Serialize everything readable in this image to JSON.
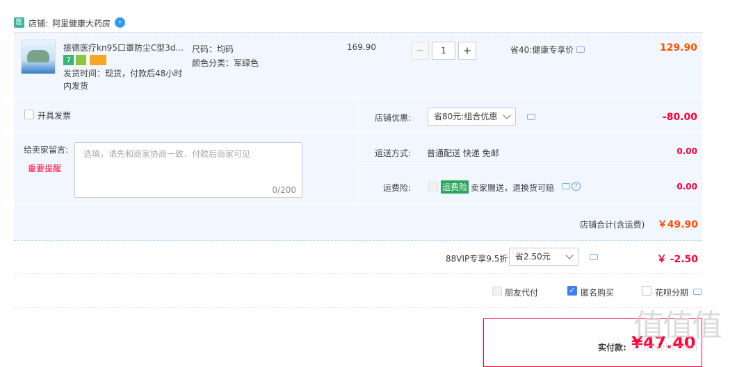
{
  "shop": {
    "label": "店铺:",
    "name": "阿里健康大药房",
    "shop_icon": "pharmacy-shop-icon",
    "badge_icon": "wangwang-chat-icon"
  },
  "item": {
    "title": "振德医疗kn95口罩防尘C型3d...",
    "ship_time": "发货时间：现货，付款后48小时内发货",
    "attr_size": "尺码：均码",
    "attr_color": "颜色分类：军绿色",
    "unit_price": "169.90",
    "quantity": "1",
    "qty_minus": "−",
    "qty_plus": "+",
    "discount": "省40:健康专享价",
    "subtotal": "129.90",
    "badge_7": "7"
  },
  "invoice": {
    "label": "开具发票"
  },
  "message": {
    "label": "给卖家留言:",
    "warn": "重要提醒",
    "placeholder": "选填，请先和商家协商一致，付款后商家可见",
    "count": "0/200"
  },
  "shop_promo": {
    "label": "店铺优惠:",
    "selected": "省80元:组合优惠",
    "amount": "-80.00"
  },
  "delivery": {
    "label": "运送方式:",
    "value": "普通配送 快递 免邮",
    "amount": "0.00"
  },
  "insurance": {
    "label": "运费险:",
    "tag": "运费险",
    "text": "卖家赠送，退换货可赔",
    "amount": "0.00"
  },
  "shop_total": {
    "label": "店铺合计(含运费)",
    "amount": "￥49.90"
  },
  "vip": {
    "label": "88VIP专享9.5折",
    "selected": "省2.50元",
    "amount": "￥ -2.50"
  },
  "options": {
    "friend_pay": "朋友代付",
    "anonymous": "匿名购买",
    "huabei": "花呗分期"
  },
  "payment": {
    "label": "实付款:",
    "amount": "¥47.40"
  },
  "watermark": {
    "text": "值值值",
    "url": "zhizhizhi.com"
  },
  "colors": {
    "price_red": "#ff0036",
    "total_orange": "#ff5000",
    "checkbox_blue": "#3d7eff",
    "row_bg": "#f2f7ff",
    "border_dash": "#b2d1ff"
  }
}
